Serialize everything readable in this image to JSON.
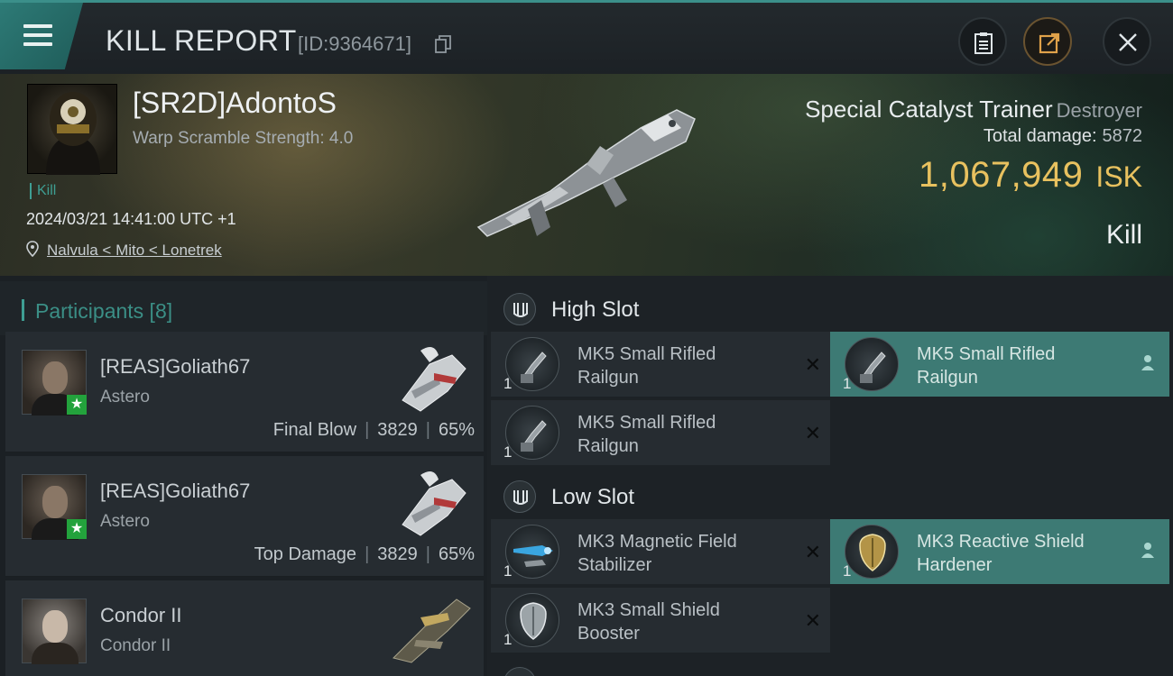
{
  "header": {
    "title": "KILL REPORT",
    "id_text": "[ID:9364671]"
  },
  "banner": {
    "pilot": "[SR2D]AdontoS",
    "warp_scramble": "Warp Scramble Strength: 4.0",
    "tag": "Kill",
    "datetime": "2024/03/21 14:41:00 UTC +1",
    "location": "Nalvula < Mito < Lonetrek",
    "ship_name": "Special Catalyst Trainer",
    "ship_class": "Destroyer",
    "damage_label": "Total damage:",
    "damage_value": "5872",
    "isk_value": "1,067,949",
    "isk_unit": "ISK",
    "result": "Kill"
  },
  "participants": {
    "title": "Participants [8]",
    "items": [
      {
        "name": "[REAS]Goliath67",
        "ship": "Astero",
        "role": "Final Blow",
        "damage": "3829",
        "percent": "65%"
      },
      {
        "name": "[REAS]Goliath67",
        "ship": "Astero",
        "role": "Top Damage",
        "damage": "3829",
        "percent": "65%"
      },
      {
        "name": "Condor II",
        "ship": "Condor II"
      }
    ]
  },
  "fitting": {
    "high_slot_label": "High Slot",
    "low_slot_label": "Low Slot",
    "high": [
      {
        "name": "MK5 Small Rifled Railgun",
        "qty": "1",
        "state": "destroyed"
      },
      {
        "name": "MK5 Small Rifled Railgun",
        "qty": "1",
        "state": "dropped"
      },
      {
        "name": "MK5 Small Rifled Railgun",
        "qty": "1",
        "state": "destroyed"
      }
    ],
    "low": [
      {
        "name": "MK3 Magnetic Field Stabilizer",
        "qty": "1",
        "state": "destroyed"
      },
      {
        "name": "MK3 Reactive Shield Hardener",
        "qty": "1",
        "state": "dropped"
      },
      {
        "name": "MK3 Small Shield Booster",
        "qty": "1",
        "state": "destroyed"
      }
    ]
  },
  "colors": {
    "accent": "#3e9e93",
    "isk": "#e8c15f",
    "active_slot": "#3d7a74"
  }
}
